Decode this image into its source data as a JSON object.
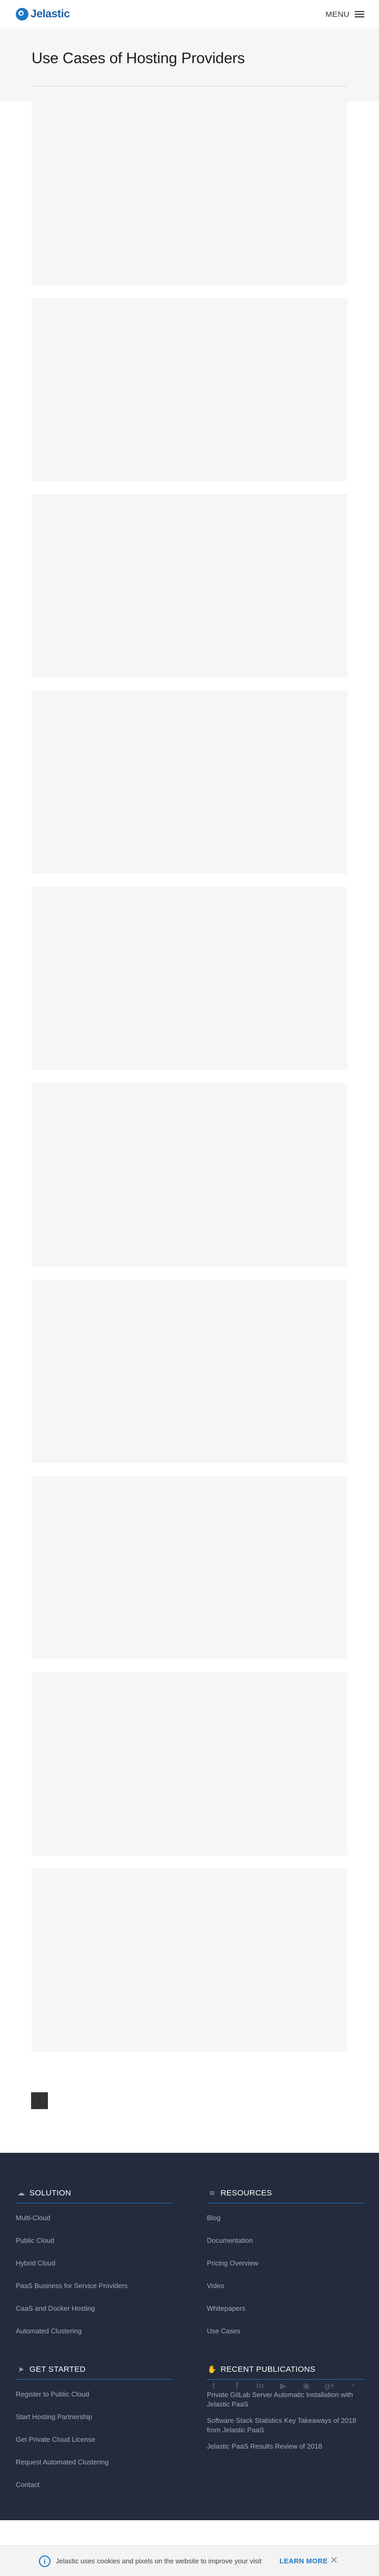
{
  "header": {
    "logo_text": "Jelastic",
    "menu_label": "MENU"
  },
  "hero": {
    "title": "Use Cases of Hosting Providers"
  },
  "cards": [
    {
      "title": ""
    },
    {
      "title": ""
    },
    {
      "title": ""
    },
    {
      "title": ""
    },
    {
      "title": ""
    },
    {
      "title": ""
    },
    {
      "title": ""
    },
    {
      "title": ""
    },
    {
      "title": ""
    },
    {
      "title": ""
    }
  ],
  "footer": {
    "solution": {
      "title": "SOLUTION",
      "icon": "cloud-icon",
      "links": [
        "Multi-Cloud",
        "Public Cloud",
        "Hybrid Cloud",
        "PaaS Business for Service Providers",
        "CaaS and Docker Hosting",
        "Automated Clustering"
      ]
    },
    "resources": {
      "title": "RESOURCES",
      "icon": "layers-icon",
      "links": [
        "Blog",
        "Documentation",
        "Pricing Overview",
        "Video",
        "Whitepapers",
        "Use Cases"
      ]
    },
    "get_started": {
      "title": "GET STARTED",
      "icon": "paper-plane-icon",
      "links": [
        "Register to Public Cloud",
        "Start Hosting Partnership",
        "Get Private Cloud License",
        "Request Automated Clustering",
        "Contact"
      ]
    },
    "recent_publications": {
      "title": "RECENT PUBLICATIONS",
      "icon": "thumbs-up-icon",
      "items": [
        "Private GitLab Server Automatic Installation with Jelastic PaaS",
        "Software Stack Statistics Key Takeaways of 2018 from Jelastic PaaS",
        "Jelastic PaaS Results Review of 2018"
      ]
    },
    "social": [
      "twitter-icon",
      "facebook-icon",
      "linkedin-icon",
      "youtube-icon",
      "github-icon",
      "google-plus-icon",
      "rss-icon"
    ]
  },
  "cookie": {
    "text": "Jelastic uses cookies and pixels on the website to improve your visit",
    "learn_more": "LEARN MORE"
  },
  "colors": {
    "brand": "#1e77c6",
    "footer_bg": "#242b3d",
    "card_bg": "#f6f6f6"
  }
}
